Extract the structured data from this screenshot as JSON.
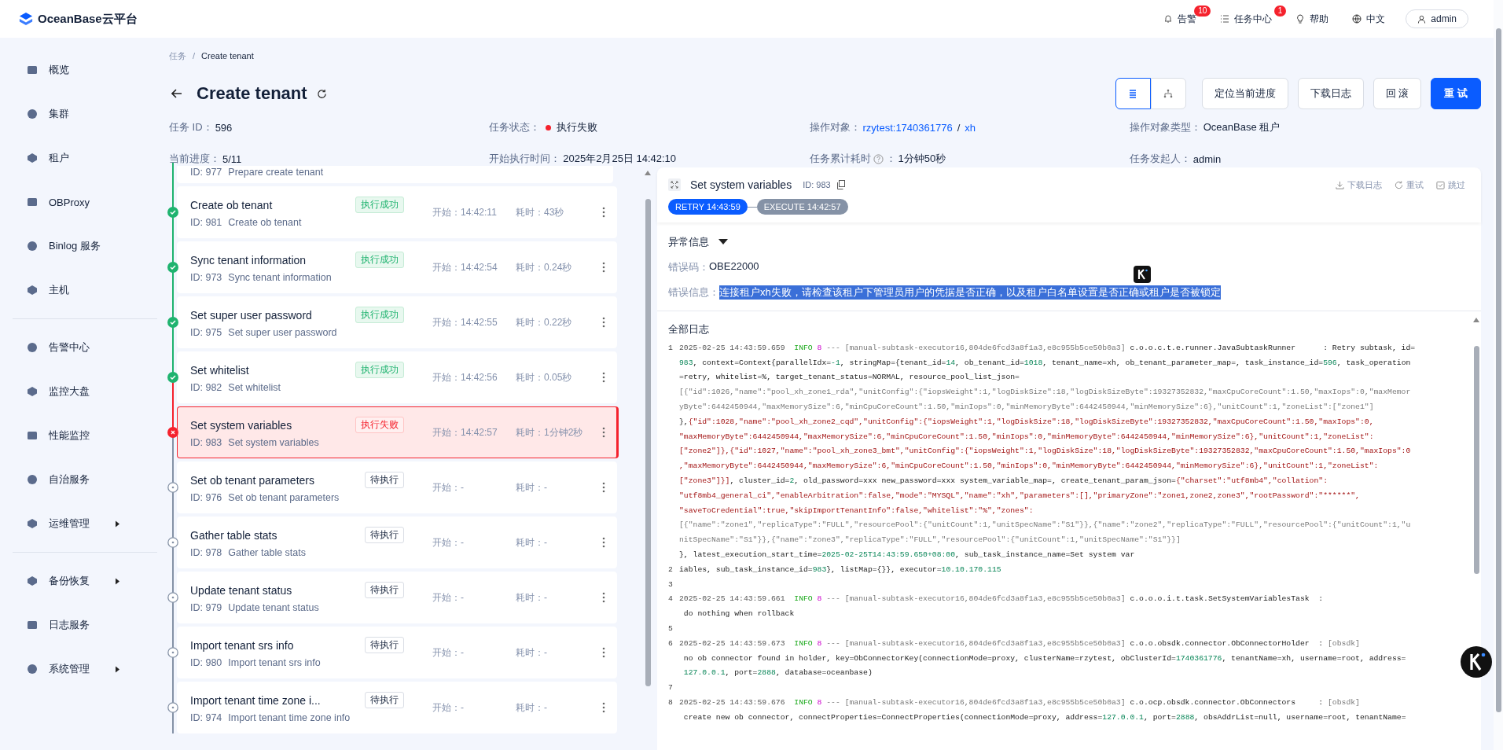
{
  "topbar": {
    "logo": "OceanBase云平台",
    "items": [
      {
        "kind": "bell",
        "label": "告警",
        "badge": "10"
      },
      {
        "kind": "list",
        "label": "任务中心",
        "badge": "1"
      },
      {
        "kind": "help",
        "label": "帮助"
      },
      {
        "kind": "globe",
        "label": "中文"
      }
    ],
    "user": "admin"
  },
  "sidebar": {
    "groups": [
      [
        {
          "label": "概览",
          "has_submenu": false
        },
        {
          "label": "集群",
          "has_submenu": false
        },
        {
          "label": "租户",
          "has_submenu": false
        },
        {
          "label": "OBProxy",
          "has_submenu": false
        },
        {
          "label": "Binlog 服务",
          "has_submenu": false
        },
        {
          "label": "主机",
          "has_submenu": false
        }
      ],
      [
        {
          "label": "告警中心",
          "has_submenu": false
        },
        {
          "label": "监控大盘",
          "has_submenu": false
        },
        {
          "label": "性能监控",
          "has_submenu": false
        },
        {
          "label": "自治服务",
          "has_submenu": false
        },
        {
          "label": "运维管理",
          "has_submenu": true
        }
      ],
      [
        {
          "label": "备份恢复",
          "has_submenu": true
        },
        {
          "label": "日志服务",
          "has_submenu": false
        },
        {
          "label": "系统管理",
          "has_submenu": true
        }
      ]
    ]
  },
  "breadcrumb": {
    "items": [
      "任务",
      "Create tenant"
    ],
    "separator": "/"
  },
  "title": "Create tenant",
  "view_toggle": [
    {
      "kind": "list",
      "selected": true
    },
    {
      "kind": "tree",
      "selected": false
    }
  ],
  "actions": [
    {
      "label": "定位当前进度",
      "kind": "default"
    },
    {
      "label": "下载日志",
      "kind": "default"
    },
    {
      "label": "回 滚",
      "kind": "default"
    },
    {
      "label": "重 试",
      "kind": "primary"
    }
  ],
  "info": [
    {
      "label": "任务 ID：",
      "kind": "text",
      "value": "596"
    },
    {
      "label": "任务状态：",
      "kind": "status",
      "value": "执行失败",
      "color": "#f5222d"
    },
    {
      "label": "操作对象：",
      "kind": "links",
      "links": [
        "rzytest:1740361776",
        "xh"
      ],
      "separator": "/"
    },
    {
      "label": "操作对象类型：",
      "kind": "text",
      "value": "OceanBase 租户"
    },
    {
      "label": "当前进度：",
      "kind": "text",
      "value": "5/11"
    },
    {
      "label": "开始执行时间：",
      "kind": "text",
      "value": "2025年2月25日 14:42:10"
    },
    {
      "label": "任务累计耗时",
      "kind": "help",
      "suffix": "：",
      "value": "1分钟50秒"
    },
    {
      "label": "任务发起人：",
      "kind": "text",
      "value": "admin"
    }
  ],
  "task_list": {
    "partial": {
      "id": "ID: 977",
      "desc": "Prepare create tenant"
    },
    "items": [
      {
        "title": "Create ob tenant",
        "id": "ID: 981",
        "desc": "Create ob tenant",
        "kind": "success",
        "status_label": "执行成功",
        "start": "开始：14:42:11",
        "duration": "耗时：43秒",
        "selected": false
      },
      {
        "title": "Sync tenant information",
        "id": "ID: 973",
        "desc": "Sync tenant information",
        "kind": "success",
        "status_label": "执行成功",
        "start": "开始：14:42:54",
        "duration": "耗时：0.24秒",
        "selected": false
      },
      {
        "title": "Set super user password",
        "id": "ID: 975",
        "desc": "Set super user password",
        "kind": "success",
        "status_label": "执行成功",
        "start": "开始：14:42:55",
        "duration": "耗时：0.22秒",
        "selected": false
      },
      {
        "title": "Set whitelist",
        "id": "ID: 982",
        "desc": "Set whitelist",
        "kind": "success",
        "status_label": "执行成功",
        "start": "开始：14:42:56",
        "duration": "耗时：0.05秒",
        "selected": false
      },
      {
        "title": "Set system variables",
        "id": "ID: 983",
        "desc": "Set system variables",
        "kind": "failed",
        "status_label": "执行失败",
        "start": "开始：14:42:57",
        "duration": "耗时：1分钟2秒",
        "selected": true
      },
      {
        "title": "Set ob tenant parameters",
        "id": "ID: 976",
        "desc": "Set ob tenant parameters",
        "kind": "pending",
        "status_label": "待执行",
        "start": "开始：-",
        "duration": "耗时：-",
        "selected": false
      },
      {
        "title": "Gather table stats",
        "id": "ID: 978",
        "desc": "Gather table stats",
        "kind": "pending",
        "status_label": "待执行",
        "start": "开始：-",
        "duration": "耗时：-",
        "selected": false
      },
      {
        "title": "Update tenant status",
        "id": "ID: 979",
        "desc": "Update tenant status",
        "kind": "pending",
        "status_label": "待执行",
        "start": "开始：-",
        "duration": "耗时：-",
        "selected": false
      },
      {
        "title": "Import tenant srs info",
        "id": "ID: 980",
        "desc": "Import tenant srs info",
        "kind": "pending",
        "status_label": "待执行",
        "start": "开始：-",
        "duration": "耗时：-",
        "selected": false
      },
      {
        "title": "Import tenant time zone i...",
        "id": "ID: 974",
        "desc": "Import tenant time zone info",
        "kind": "pending",
        "status_label": "待执行",
        "start": "开始：-",
        "duration": "耗时：-",
        "selected": false
      }
    ]
  },
  "detail": {
    "title": "Set system variables",
    "id": "ID: 983",
    "actions": [
      {
        "kind": "download",
        "label": "下载日志"
      },
      {
        "kind": "retry",
        "label": "重试"
      },
      {
        "kind": "skip",
        "label": "跳过"
      }
    ],
    "attempts": [
      {
        "label": "RETRY 14:43:59",
        "selected": true
      },
      {
        "label": "EXECUTE 14:42:57",
        "selected": false
      }
    ],
    "error": {
      "heading": "异常信息",
      "expanded": true,
      "code_label": "错误码：",
      "code": "OBE22000",
      "message_label": "错误信息：",
      "message": "连接租户xh失败，请检查该租户下管理员用户的凭据是否正确，以及租户白名单设置是否正确或租户是否被锁定",
      "message_selected": true
    },
    "log": {
      "heading": "全部日志",
      "rows": [
        {
          "no": "1",
          "segs": [
            {
              "text": "2025-02-25 14:43:59.659",
              "kind": "t"
            },
            {
              "text": "  INFO",
              "kind": "lv"
            },
            {
              "text": " 8",
              "kind": "pid"
            },
            {
              "text": " --- [manual-subtask-executor16,804de6fcd3a8f1a3,e8c955b5ce50b0a3]",
              "kind": "th"
            },
            {
              "text": " c.o.o.c.t.e.runner.JavaSubtaskRunner      : Retry subtask, id=",
              "kind": "c"
            }
          ]
        },
        {
          "segs": [
            {
              "text": "983",
              "kind": "n"
            },
            {
              "text": ", context=Context{parallelIdx=",
              "kind": "c"
            },
            {
              "text": "-1",
              "kind": "n"
            },
            {
              "text": ", stringMap={tenant_id=",
              "kind": "c"
            },
            {
              "text": "14",
              "kind": "n"
            },
            {
              "text": ", ob_tenant_id=",
              "kind": "c"
            },
            {
              "text": "1018",
              "kind": "n"
            },
            {
              "text": ", tenant_name=xh, ob_tenant_parameter_map=, task_instance_id=",
              "kind": "c"
            },
            {
              "text": "596",
              "kind": "n"
            },
            {
              "text": ", task_operation",
              "kind": "c"
            }
          ]
        },
        {
          "segs": [
            {
              "text": "=retry, whitelist=%, target_tenant_status=NORMAL, resource_pool_list_json=",
              "kind": "c"
            }
          ]
        },
        {
          "segs": [
            {
              "text": "[{\"id\":1026,\"name\":\"pool_xh_zone1_rda\",\"unitConfig\":{\"iopsWeight\":1,\"logDiskSize\":18,\"logDiskSizeByte\":19327352832,\"maxCpuCoreCount\":1.50,\"maxIops\":0,\"maxMemor",
              "kind": "j"
            }
          ]
        },
        {
          "segs": [
            {
              "text": "yByte\":6442450944,\"maxMemorySize\":6,\"minCpuCoreCount\":1.50,\"minIops\":0,\"minMemoryByte\":6442450944,\"minMemorySize\":6},\"unitCount\":1,\"zoneList\":[\"zone1\"]",
              "kind": "j"
            }
          ]
        },
        {
          "segs": [
            {
              "text": "},",
              "kind": "c"
            },
            {
              "text": "{\"id\":1028,\"name\":\"pool_xh_zone2_cqd\",\"unitConfig\":{\"iopsWeight\":1,\"logDiskSize\":18,\"logDiskSizeByte\":19327352832,\"maxCpuCoreCount\":1.50,\"maxIops\":0,",
              "kind": "k"
            }
          ]
        },
        {
          "segs": [
            {
              "text": "\"maxMemoryByte\":6442450944,\"maxMemorySize\":6,\"minCpuCoreCount\":1.50,\"minIops\":0,\"minMemoryByte\":6442450944,\"minMemorySize\":6},\"unitCount\":1,\"zoneList\":",
              "kind": "k"
            }
          ]
        },
        {
          "segs": [
            {
              "text": "[\"zone2\"]},{\"id\":1027,\"name\":\"pool_xh_zone3_bmt\",\"unitConfig\":{\"iopsWeight\":1,\"logDiskSize\":18,\"logDiskSizeByte\":19327352832,\"maxCpuCoreCount\":1.50,\"maxIops\":0",
              "kind": "k"
            }
          ]
        },
        {
          "segs": [
            {
              "text": ",\"maxMemoryByte\":6442450944,\"maxMemorySize\":6,\"minCpuCoreCount\":1.50,\"minIops\":0,\"minMemoryByte\":6442450944,\"minMemorySize\":6},\"unitCount\":1,\"zoneList\":",
              "kind": "k"
            }
          ]
        },
        {
          "segs": [
            {
              "text": "[\"zone3\"]}]",
              "kind": "k"
            },
            {
              "text": ", cluster_id=",
              "kind": "c"
            },
            {
              "text": "2",
              "kind": "n"
            },
            {
              "text": ", old_password=xxx new_password=xxx system_variable_map=, create_tenant_param_json=",
              "kind": "c"
            },
            {
              "text": "{\"charset\":\"utf8mb4\",\"collation\":",
              "kind": "k"
            }
          ]
        },
        {
          "segs": [
            {
              "text": "\"utf8mb4_general_ci\",\"enableArbitration\":false,\"mode\":\"MYSQL\",\"name\":\"xh\",\"parameters\":[],\"primaryZone\":\"zone1,zone2,zone3\",\"rootPassword\":\"******\",",
              "kind": "k"
            }
          ]
        },
        {
          "segs": [
            {
              "text": "\"saveToCredential\":true,\"skipImportTenantInfo\":false,\"whitelist\":\"%\",\"zones\":",
              "kind": "k"
            }
          ]
        },
        {
          "segs": [
            {
              "text": "[{\"name\":\"zone1\",\"replicaType\":\"FULL\",\"resourcePool\":{\"unitCount\":1,\"unitSpecName\":\"S1\"}},{\"name\":\"zone2\",\"replicaType\":\"FULL\",\"resourcePool\":{\"unitCount\":1,\"u",
              "kind": "j"
            }
          ]
        },
        {
          "segs": [
            {
              "text": "nitSpecName\":\"S1\"}},{\"name\":\"zone3\",\"replicaType\":\"FULL\",\"resourcePool\":{\"unitCount\":1,\"unitSpecName\":\"S1\"}}]",
              "kind": "j"
            }
          ]
        },
        {
          "segs": [
            {
              "text": "}, latest_execution_start_time=",
              "kind": "c"
            },
            {
              "text": "2025-02-25T14:43:59.650+08:00",
              "kind": "n"
            },
            {
              "text": ", sub_task_instance_name=Set system var",
              "kind": "c"
            }
          ]
        },
        {
          "no": "2",
          "segs": [
            {
              "text": "iables, sub_task_instance_id=",
              "kind": "c"
            },
            {
              "text": "983",
              "kind": "n"
            },
            {
              "text": "}, listMap={}}, executor=",
              "kind": "c"
            },
            {
              "text": "10.10.170.115",
              "kind": "n"
            }
          ]
        },
        {
          "no": "3"
        },
        {
          "no": "4",
          "segs": [
            {
              "text": "2025-02-25 14:43:59.661",
              "kind": "t"
            },
            {
              "text": "  INFO",
              "kind": "lv"
            },
            {
              "text": " 8",
              "kind": "pid"
            },
            {
              "text": " --- [manual-subtask-executor16,804de6fcd3a8f1a3,e8c955b5ce50b0a3]",
              "kind": "th"
            },
            {
              "text": " c.o.o.o.i.t.task.SetSystemVariablesTask  :",
              "kind": "c"
            }
          ]
        },
        {
          "segs": [
            {
              "text": " do nothing when rollback",
              "kind": "c"
            }
          ]
        },
        {
          "no": "5"
        },
        {
          "no": "6",
          "segs": [
            {
              "text": "2025-02-25 14:43:59.673",
              "kind": "t"
            },
            {
              "text": "  INFO",
              "kind": "lv"
            },
            {
              "text": " 8",
              "kind": "pid"
            },
            {
              "text": " --- [manual-subtask-executor16,804de6fcd3a8f1a3,e8c955b5ce50b0a3]",
              "kind": "th"
            },
            {
              "text": " c.o.o.obsdk.connector.ObConnectorHolder  :",
              "kind": "c"
            },
            {
              "text": " [obsdk]",
              "kind": "th"
            }
          ]
        },
        {
          "segs": [
            {
              "text": " no ob connector found in holder, key=ObConnectorKey(connectionMode=proxy, clusterName=rzytest, obClusterId=",
              "kind": "c"
            },
            {
              "text": "1740361776",
              "kind": "n"
            },
            {
              "text": ", tenantName=xh, username=root, address=",
              "kind": "c"
            }
          ]
        },
        {
          "segs": [
            {
              "text": " 127.0.0.1",
              "kind": "n"
            },
            {
              "text": ", port=",
              "kind": "c"
            },
            {
              "text": "2888",
              "kind": "n"
            },
            {
              "text": ", database=oceanbase)",
              "kind": "c"
            }
          ]
        },
        {
          "no": "7"
        },
        {
          "no": "8",
          "segs": [
            {
              "text": "2025-02-25 14:43:59.676",
              "kind": "t"
            },
            {
              "text": "  INFO",
              "kind": "lv"
            },
            {
              "text": " 8",
              "kind": "pid"
            },
            {
              "text": " --- [manual-subtask-executor16,804de6fcd3a8f1a3,e8c955b5ce50b0a3]",
              "kind": "th"
            },
            {
              "text": " c.o.ocp.obsdk.connector.ObConnectors     :",
              "kind": "c"
            },
            {
              "text": " [obsdk]",
              "kind": "th"
            }
          ]
        },
        {
          "segs": [
            {
              "text": " create new ob connector, connectProperties=ConnectProperties(connectionMode=proxy, address=",
              "kind": "c"
            },
            {
              "text": "127.0.0.1",
              "kind": "n"
            },
            {
              "text": ", port=",
              "kind": "c"
            },
            {
              "text": "2888",
              "kind": "n"
            },
            {
              "text": ", obsAddrList=null, username=root, tenantName=",
              "kind": "c"
            }
          ]
        }
      ]
    }
  }
}
